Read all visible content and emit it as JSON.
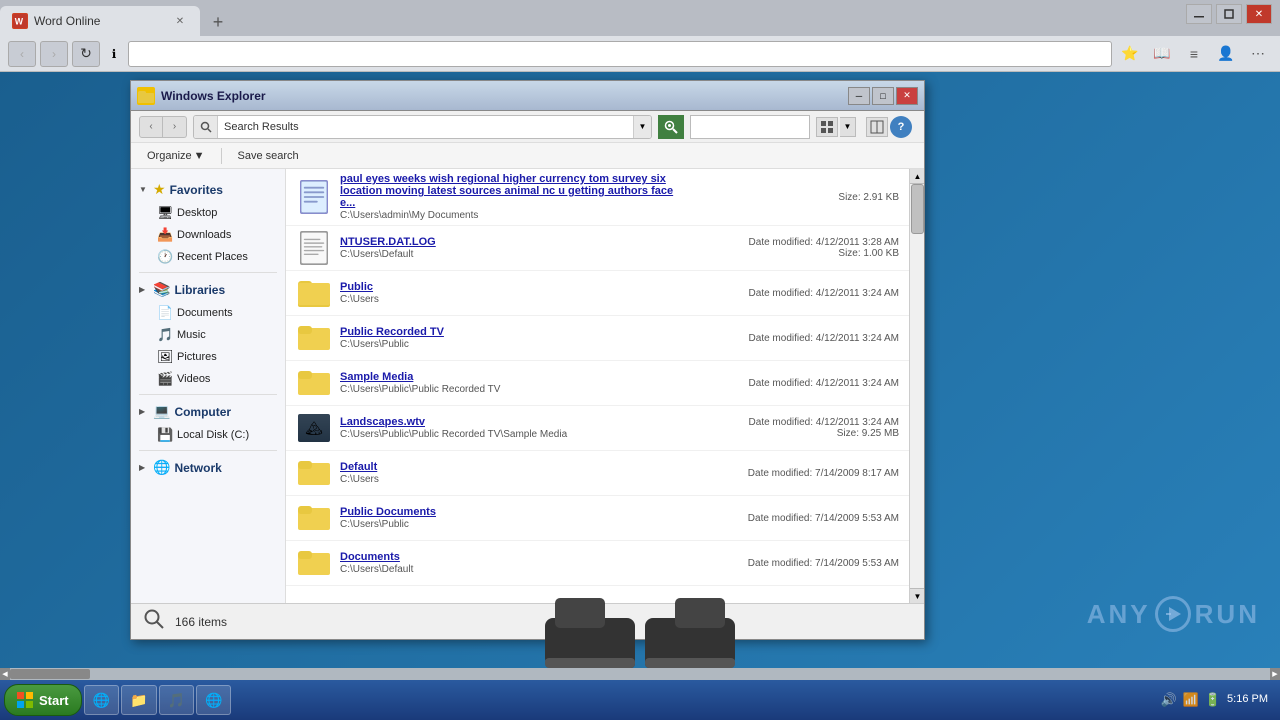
{
  "browser": {
    "tab_title": "Word Online",
    "tab_favicon": "W",
    "new_tab_icon": "+",
    "address_bar_text": "",
    "nav_back": "‹",
    "nav_forward": "›",
    "nav_refresh": "↺",
    "nav_security": "ℹ",
    "win_minimize": "─",
    "win_maximize": "□",
    "win_restore": "❐",
    "win_close": "✕"
  },
  "explorer": {
    "title": "Windows Explorer",
    "win_minimize": "─",
    "win_maximize": "□",
    "win_close": "✕",
    "toolbar": {
      "organize_label": "Organize",
      "save_search_label": "Save search",
      "search_placeholder": "Search Results",
      "help_label": "?"
    },
    "sidebar": {
      "favorites_label": "Favorites",
      "favorites_items": [
        {
          "label": "Desktop",
          "icon": "🖥"
        },
        {
          "label": "Downloads",
          "icon": "📥"
        },
        {
          "label": "Recent Places",
          "icon": "🕐"
        }
      ],
      "libraries_label": "Libraries",
      "libraries_items": [
        {
          "label": "Documents",
          "icon": "📄"
        },
        {
          "label": "Music",
          "icon": "🎵"
        },
        {
          "label": "Pictures",
          "icon": "🖼"
        },
        {
          "label": "Videos",
          "icon": "🎬"
        }
      ],
      "computer_label": "Computer",
      "computer_items": [
        {
          "label": "Local Disk (C:)",
          "icon": "💾"
        }
      ],
      "network_label": "Network",
      "network_items": []
    },
    "files": [
      {
        "type": "doc",
        "name": "paul eyes weeks wish regional higher currency tom survey six location moving latest sources animal nc u getting authors face e...",
        "path": "C:\\Users\\admin\\My Documents",
        "meta": "Size: 2.91 KB",
        "meta2": ""
      },
      {
        "type": "log",
        "name": "NTUSER.DAT.LOG",
        "path": "C:\\Users\\Default",
        "meta": "Date modified: 4/12/2011 3:28 AM",
        "meta2": "Size: 1.00 KB"
      },
      {
        "type": "folder",
        "name": "Public",
        "path": "C:\\Users",
        "meta": "Date modified: 4/12/2011 3:24 AM",
        "meta2": ""
      },
      {
        "type": "folder",
        "name": "Public Recorded TV",
        "path": "C:\\Users\\Public",
        "meta": "Date modified: 4/12/2011 3:24 AM",
        "meta2": ""
      },
      {
        "type": "folder",
        "name": "Sample Media",
        "path": "C:\\Users\\Public\\Public Recorded TV",
        "meta": "Date modified: 4/12/2011 3:24 AM",
        "meta2": ""
      },
      {
        "type": "video",
        "name": "Landscapes.wtv",
        "path": "C:\\Users\\Public\\Public Recorded TV\\Sample Media",
        "meta": "Date modified: 4/12/2011 3:24 AM",
        "meta2": "Size: 9.25 MB"
      },
      {
        "type": "folder",
        "name": "Default",
        "path": "C:\\Users",
        "meta": "Date modified: 7/14/2009 8:17 AM",
        "meta2": ""
      },
      {
        "type": "folder",
        "name": "Public Documents",
        "path": "C:\\Users\\Public",
        "meta": "Date modified: 7/14/2009 5:53 AM",
        "meta2": ""
      },
      {
        "type": "folder",
        "name": "Documents",
        "path": "C:\\Users\\Default",
        "meta": "Date modified: 7/14/2009 5:53 AM",
        "meta2": ""
      }
    ],
    "status_items_count": "166 items"
  },
  "taskbar": {
    "start_label": "Start",
    "items": [
      {
        "icon": "🌐",
        "label": ""
      },
      {
        "icon": "📁",
        "label": ""
      },
      {
        "icon": "🛡",
        "label": ""
      },
      {
        "icon": "🎵",
        "label": ""
      },
      {
        "icon": "🌐",
        "label": ""
      }
    ],
    "clock": "5:16 PM"
  },
  "anyrun": {
    "text": "ANY",
    "text2": "RUN"
  }
}
